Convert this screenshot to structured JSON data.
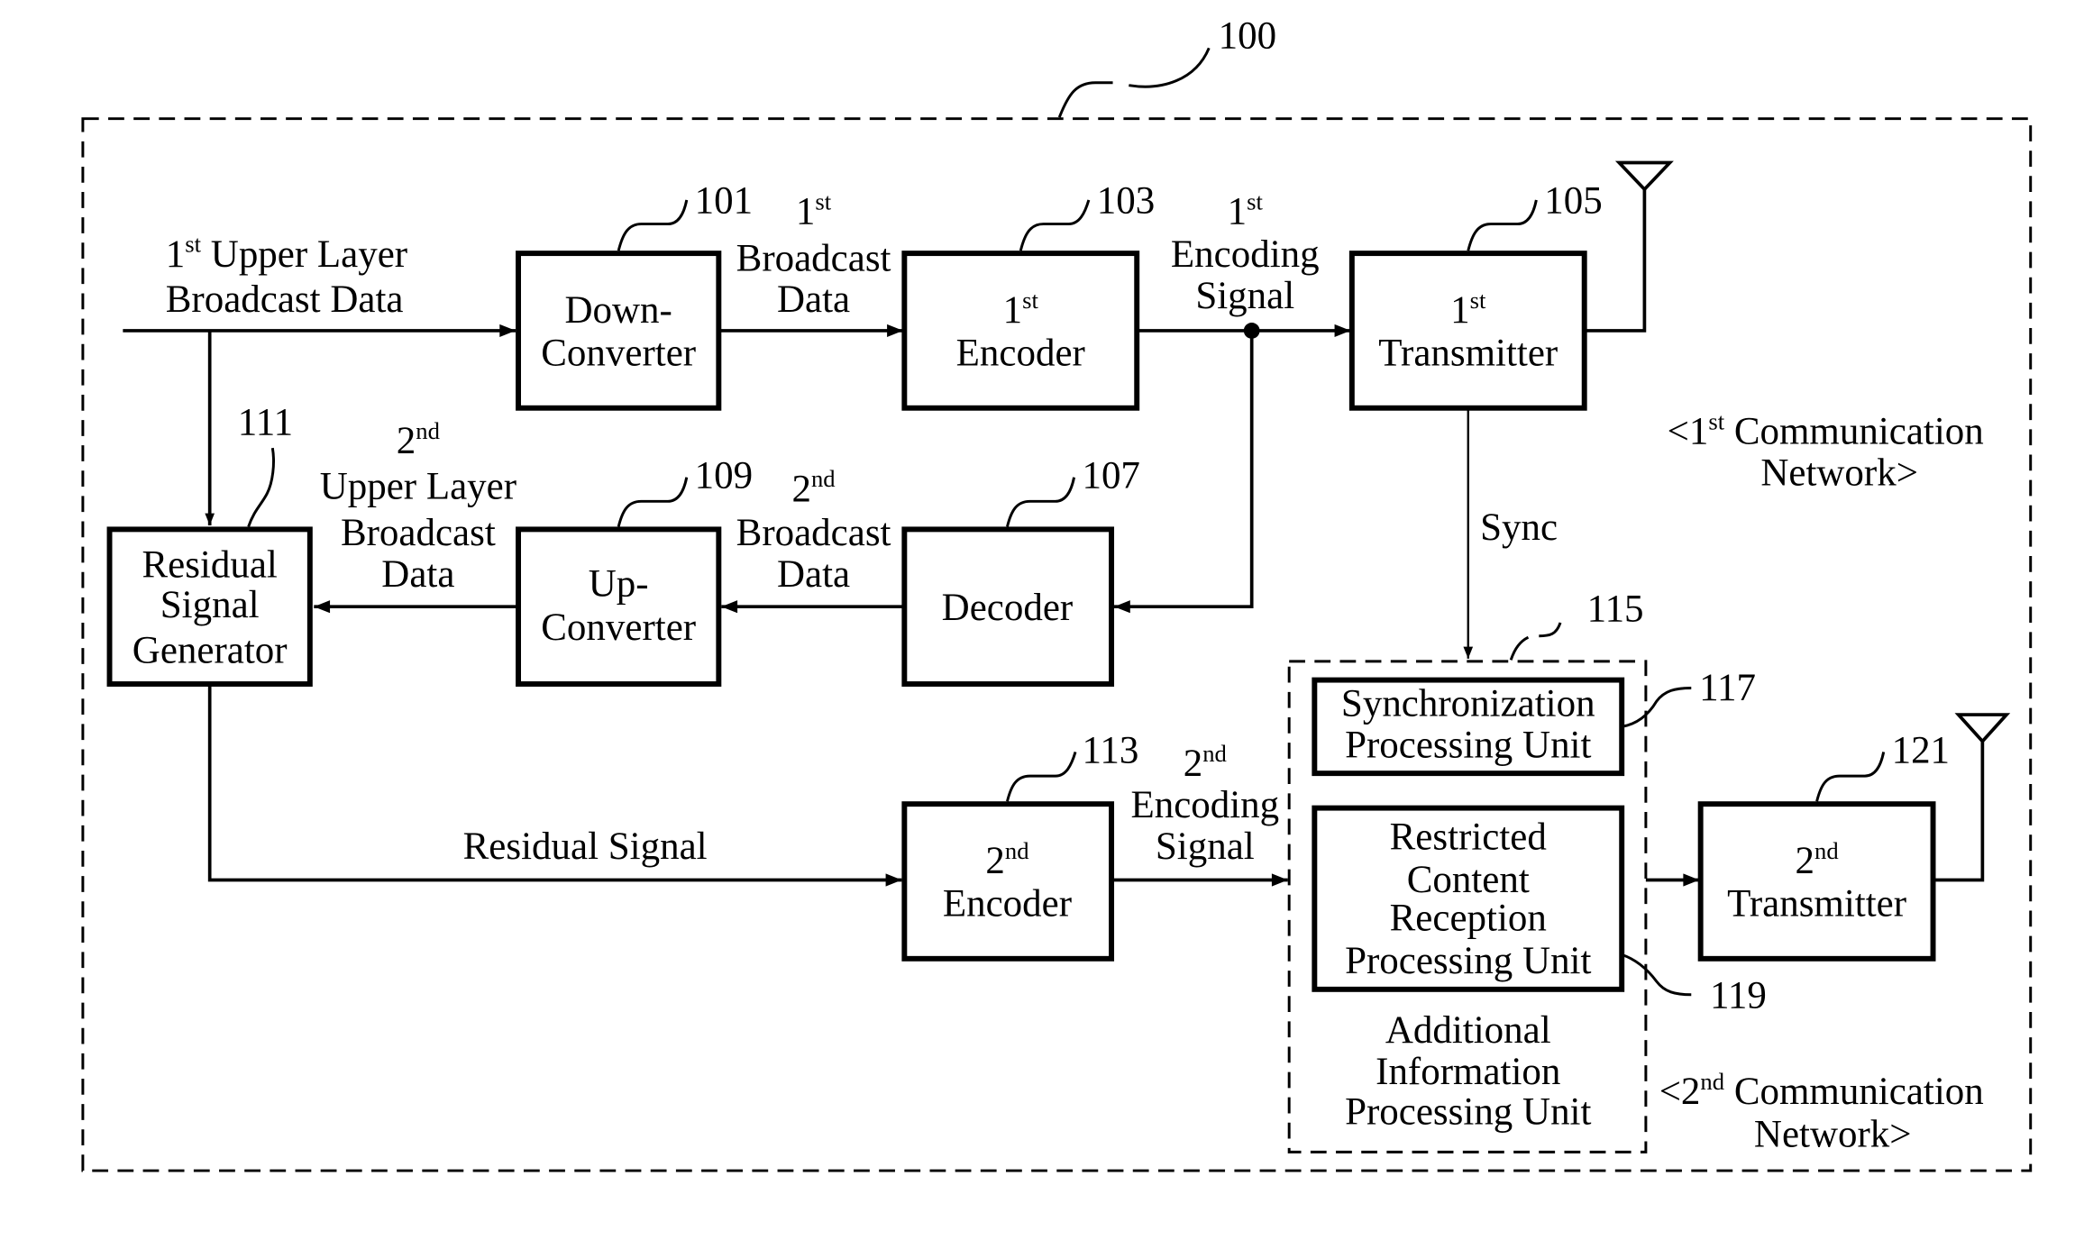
{
  "figure": {
    "system_ref": "100",
    "blocks": [
      {
        "id": "down_converter",
        "ref": "101",
        "lines": [
          "Down-",
          "Converter"
        ]
      },
      {
        "id": "encoder1",
        "ref": "103",
        "ord": "1",
        "ord_sup": "st",
        "line2": "Encoder"
      },
      {
        "id": "transmitter1",
        "ref": "105",
        "ord": "1",
        "ord_sup": "st",
        "line2": "Transmitter"
      },
      {
        "id": "decoder",
        "ref": "107",
        "lines": [
          "Decoder"
        ]
      },
      {
        "id": "up_converter",
        "ref": "109",
        "lines": [
          "Up-",
          "Converter"
        ]
      },
      {
        "id": "residual_generator",
        "ref": "111",
        "lines": [
          "Residual",
          "Signal",
          "Generator"
        ]
      },
      {
        "id": "encoder2",
        "ref": "113",
        "ord": "2",
        "ord_sup": "nd",
        "line2": "Encoder"
      },
      {
        "id": "additional_info_unit",
        "ref": "115",
        "lines": [
          "Additional",
          "Information",
          "Processing Unit"
        ]
      },
      {
        "id": "sync_unit",
        "ref": "117",
        "lines": [
          "Synchronization",
          "Processing Unit"
        ]
      },
      {
        "id": "restricted_unit",
        "ref": "119",
        "lines": [
          "Restricted",
          "Content",
          "Reception",
          "Processing Unit"
        ]
      },
      {
        "id": "transmitter2",
        "ref": "121",
        "ord": "2",
        "ord_sup": "nd",
        "line2": "Transmitter"
      }
    ],
    "signals": {
      "upper1": {
        "ord": "1",
        "ord_sup": "st",
        "line1_rest": " Upper Layer",
        "line2": "Broadcast Data"
      },
      "bcast1": {
        "ord": "1",
        "ord_sup": "st",
        "line2": "Broadcast",
        "line3": "Data"
      },
      "enc1": {
        "ord": "1",
        "ord_sup": "st",
        "line2": "Encoding",
        "line3": "Signal"
      },
      "upper2": {
        "ord": "2",
        "ord_sup": "nd",
        "line2": "Upper Layer",
        "line3": "Broadcast",
        "line4": "Data"
      },
      "bcast2": {
        "ord": "2",
        "ord_sup": "nd",
        "line2": "Broadcast",
        "line3": "Data"
      },
      "enc2": {
        "ord": "2",
        "ord_sup": "nd",
        "line2": "Encoding",
        "line3": "Signal"
      },
      "residual": "Residual Signal",
      "sync": "Sync"
    },
    "networks": {
      "net1": {
        "prefix": "<1",
        "sup": "st",
        "rest": " Communication",
        "line2": "Network>"
      },
      "net2": {
        "prefix": "<2",
        "sup": "nd",
        "rest": " Communication",
        "line2": "Network>"
      }
    }
  }
}
